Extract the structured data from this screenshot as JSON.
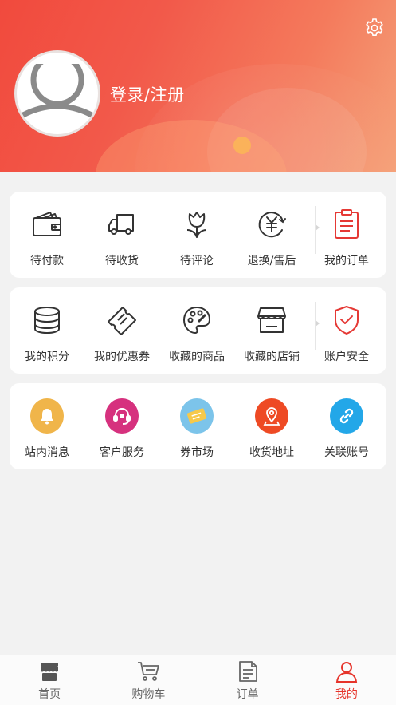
{
  "header": {
    "login_label": "登录/注册",
    "icons": {
      "settings": "gear-icon",
      "avatar": "default-avatar"
    },
    "colors": {
      "gradient_start": "#f14a3d",
      "gradient_end": "#f5a27a"
    }
  },
  "orders": {
    "items": [
      {
        "label": "待付款",
        "icon": "wallet-icon"
      },
      {
        "label": "待收货",
        "icon": "truck-icon"
      },
      {
        "label": "待评论",
        "icon": "tulip-icon"
      },
      {
        "label": "退换/售后",
        "icon": "yen-refresh-icon"
      },
      {
        "label": "我的订单",
        "icon": "order-list-icon"
      }
    ]
  },
  "assets": {
    "items": [
      {
        "label": "我的积分",
        "icon": "coins-stack-icon"
      },
      {
        "label": "我的优惠券",
        "icon": "ticket-icon"
      },
      {
        "label": "收藏的商品",
        "icon": "palette-icon"
      },
      {
        "label": "收藏的店铺",
        "icon": "storefront-icon"
      },
      {
        "label": "账户安全",
        "icon": "shield-check-icon"
      }
    ]
  },
  "services": {
    "items": [
      {
        "label": "站内消息",
        "icon": "bell-icon",
        "color": "#f0b54a"
      },
      {
        "label": "客户服务",
        "icon": "headset-icon",
        "color": "#d6317e"
      },
      {
        "label": "券市场",
        "icon": "coupon-icon",
        "color": "#7cc4ea"
      },
      {
        "label": "收货地址",
        "icon": "location-pin-icon",
        "color": "#ee4a24"
      },
      {
        "label": "关联账号",
        "icon": "link-icon",
        "color": "#23a7e8"
      }
    ]
  },
  "tabbar": {
    "tabs": [
      {
        "label": "首页",
        "icon": "shop-icon"
      },
      {
        "label": "购物车",
        "icon": "cart-icon"
      },
      {
        "label": "订单",
        "icon": "document-icon"
      },
      {
        "label": "我的",
        "icon": "person-icon"
      }
    ],
    "active_color": "#e6342b"
  }
}
